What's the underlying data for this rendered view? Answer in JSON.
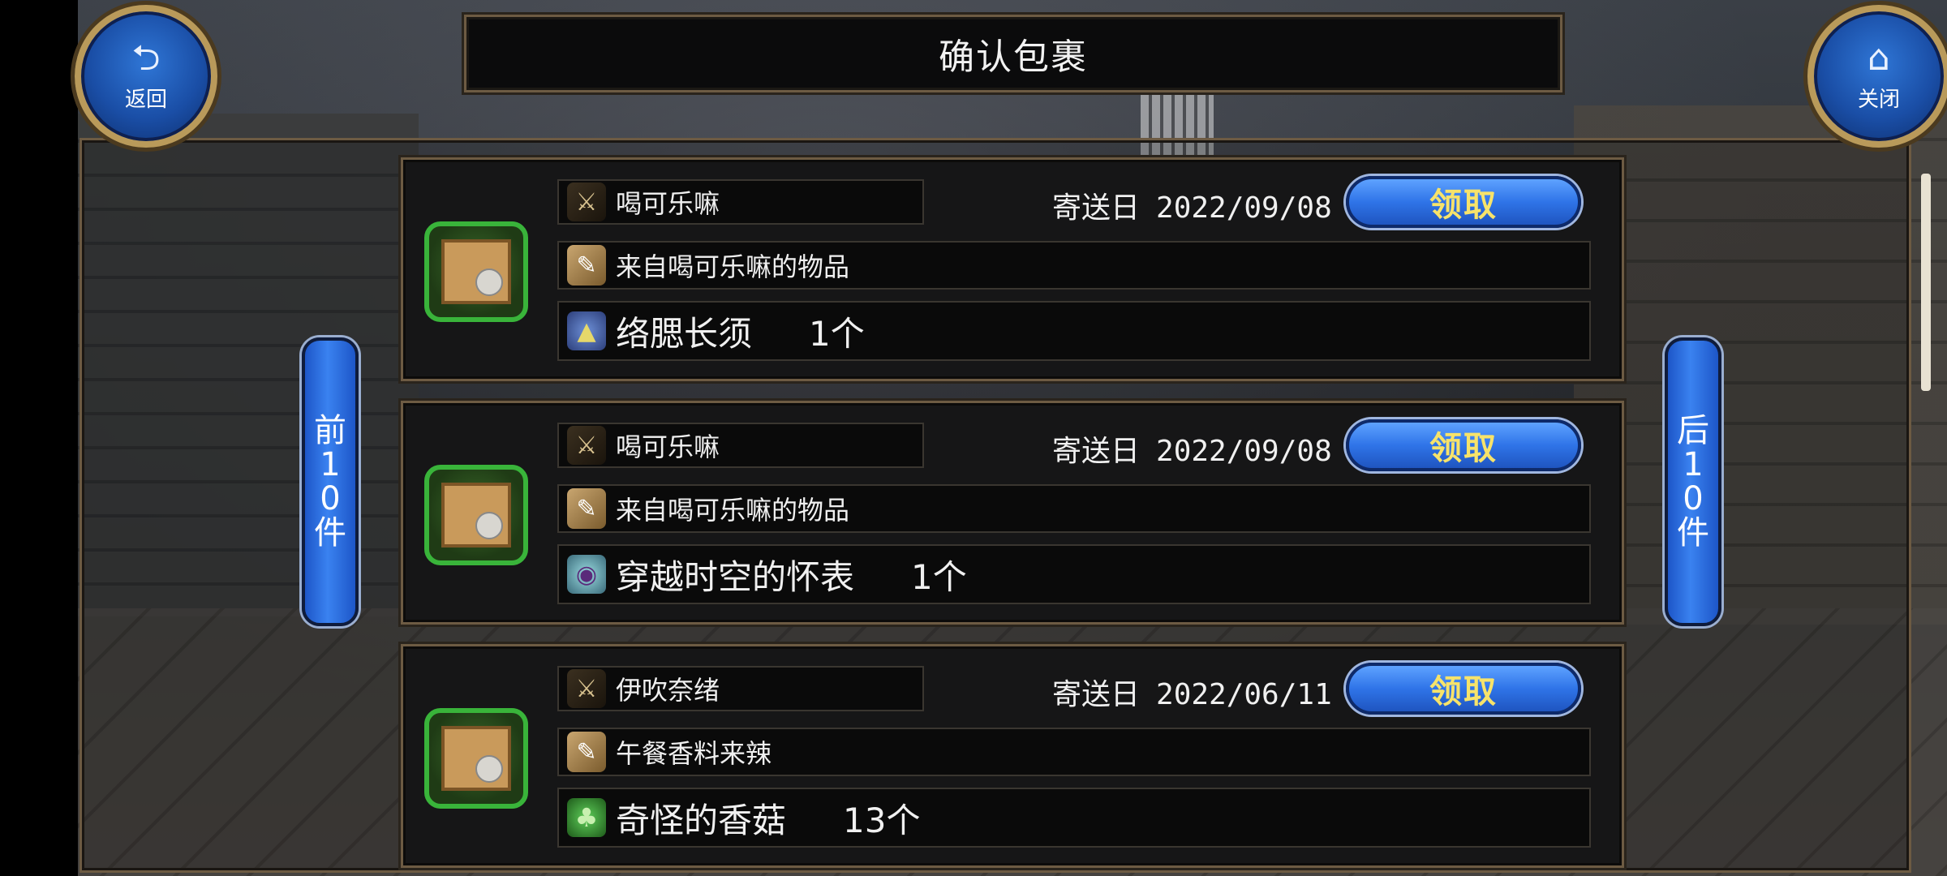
{
  "header": {
    "title": "确认包裹",
    "back_label": "返回",
    "close_label": "关闭",
    "back_icon": "return-arrow-icon",
    "close_icon": "home-icon"
  },
  "nav": {
    "prev_label": "前10件",
    "next_label": "后10件"
  },
  "packages": [
    {
      "sender": "喝可乐嘛",
      "date_label": "寄送日",
      "date": "2022/09/08",
      "claim_label": "领取",
      "subject": "来自喝可乐嘛的物品",
      "item_name": "络腮长须",
      "item_qty": "1个",
      "item_icon": "beard-icon"
    },
    {
      "sender": "喝可乐嘛",
      "date_label": "寄送日",
      "date": "2022/09/08",
      "claim_label": "领取",
      "subject": "来自喝可乐嘛的物品",
      "item_name": "穿越时空的怀表",
      "item_qty": "1个",
      "item_icon": "pocket-watch-icon"
    },
    {
      "sender": "伊吹奈绪",
      "date_label": "寄送日",
      "date": "2022/06/11",
      "claim_label": "领取",
      "subject": "午餐香料来辣",
      "item_name": "奇怪的香菇",
      "item_qty": "13个",
      "item_icon": "mushroom-icon"
    }
  ],
  "colors": {
    "frame_gold": "#6d5b43",
    "button_blue": "#2f74e8",
    "claim_text": "#f7e36a",
    "package_border": "#39b43a"
  }
}
